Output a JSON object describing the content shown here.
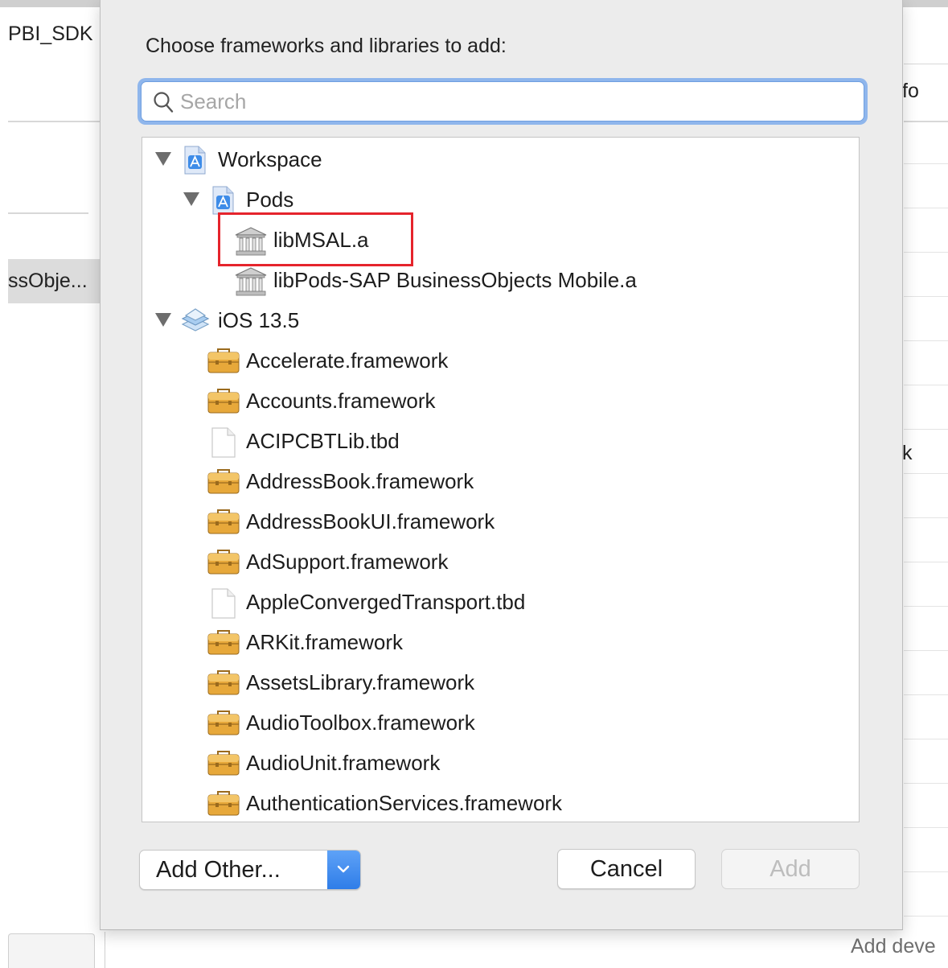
{
  "background": {
    "left_title": "PBI_SDK",
    "left_selected_item": "ssObje...",
    "right_text_top": "fo",
    "right_text_mid": "k",
    "bottom_right_text": "Add deve"
  },
  "dialog": {
    "title": "Choose frameworks and libraries to add:",
    "search": {
      "placeholder": "Search",
      "value": ""
    },
    "tree": [
      {
        "label": "Workspace",
        "icon": "xcode-workspace-icon",
        "expanded": true,
        "level": 0
      },
      {
        "label": "Pods",
        "icon": "xcode-project-icon",
        "expanded": true,
        "level": 1
      },
      {
        "label": "libMSAL.a",
        "icon": "library-icon",
        "level": 2,
        "highlighted": true
      },
      {
        "label": "libPods-SAP BusinessObjects Mobile.a",
        "icon": "library-icon",
        "level": 2
      },
      {
        "label": "iOS 13.5",
        "icon": "sdk-icon",
        "expanded": true,
        "level": 0
      },
      {
        "label": "Accelerate.framework",
        "icon": "framework-icon",
        "level": 1
      },
      {
        "label": "Accounts.framework",
        "icon": "framework-icon",
        "level": 1
      },
      {
        "label": "ACIPCBTLib.tbd",
        "icon": "file-icon",
        "level": 1
      },
      {
        "label": "AddressBook.framework",
        "icon": "framework-icon",
        "level": 1
      },
      {
        "label": "AddressBookUI.framework",
        "icon": "framework-icon",
        "level": 1
      },
      {
        "label": "AdSupport.framework",
        "icon": "framework-icon",
        "level": 1
      },
      {
        "label": "AppleConvergedTransport.tbd",
        "icon": "file-icon",
        "level": 1
      },
      {
        "label": "ARKit.framework",
        "icon": "framework-icon",
        "level": 1
      },
      {
        "label": "AssetsLibrary.framework",
        "icon": "framework-icon",
        "level": 1
      },
      {
        "label": "AudioToolbox.framework",
        "icon": "framework-icon",
        "level": 1
      },
      {
        "label": "AudioUnit.framework",
        "icon": "framework-icon",
        "level": 1
      },
      {
        "label": "AuthenticationServices.framework",
        "icon": "framework-icon",
        "level": 1
      }
    ],
    "buttons": {
      "add_other": "Add Other...",
      "cancel": "Cancel",
      "add": "Add"
    }
  },
  "colors": {
    "highlight": "#e5242c",
    "search_focus_ring": "#8fb6ec",
    "popup_accent": "#2f7de8",
    "framework_icon": "#e7a83a"
  }
}
